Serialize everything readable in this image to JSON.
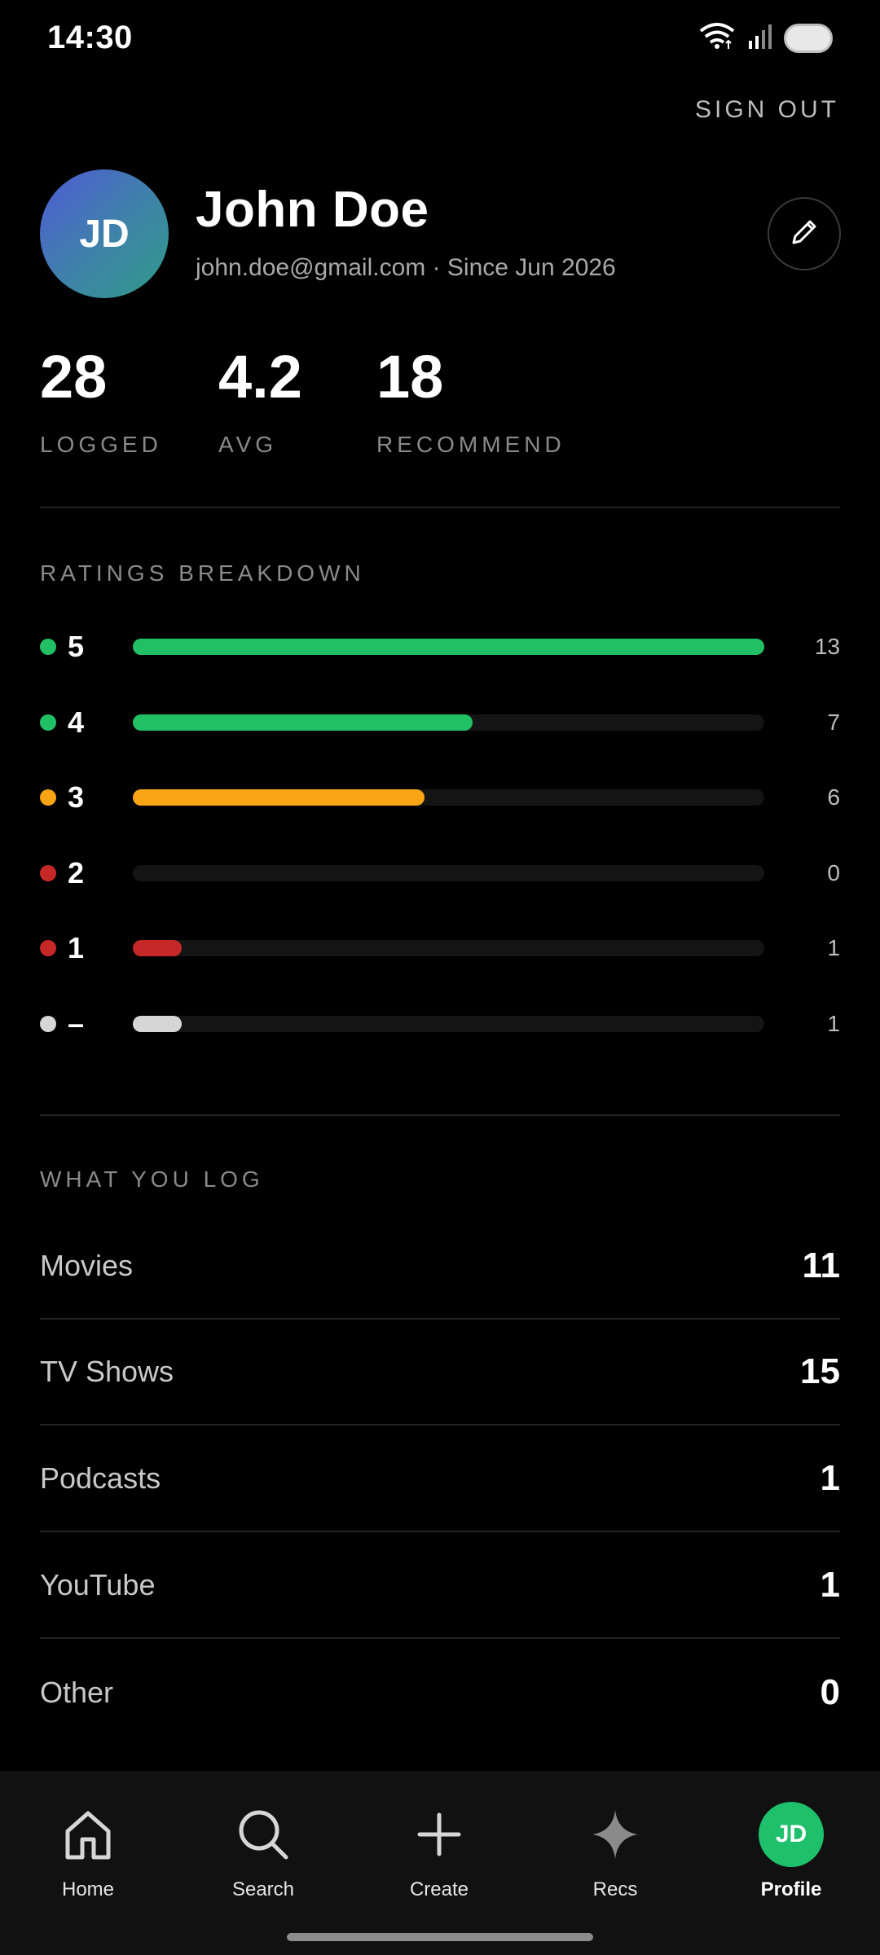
{
  "status": {
    "time": "14:30"
  },
  "header": {
    "sign_out": "SIGN OUT"
  },
  "profile": {
    "initials": "JD",
    "name": "John Doe",
    "subline": "john.doe@gmail.com · Since Jun 2026"
  },
  "stats": [
    {
      "value": "28",
      "label": "LOGGED"
    },
    {
      "value": "4.2",
      "label": "AVG"
    },
    {
      "value": "18",
      "label": "RECOMMEND"
    }
  ],
  "ratings": {
    "title": "RATINGS BREAKDOWN",
    "max": 13,
    "rows": [
      {
        "label": "5",
        "count": "13",
        "value": 13,
        "color": "#22c065"
      },
      {
        "label": "4",
        "count": "7",
        "value": 7,
        "color": "#22c065"
      },
      {
        "label": "3",
        "count": "6",
        "value": 6,
        "color": "#f9a415"
      },
      {
        "label": "2",
        "count": "0",
        "value": 0,
        "color": "#c62828"
      },
      {
        "label": "1",
        "count": "1",
        "value": 1,
        "color": "#c62828"
      },
      {
        "label": "–",
        "count": "1",
        "value": 1,
        "color": "#d6d6d6"
      }
    ]
  },
  "log": {
    "title": "WHAT YOU LOG",
    "rows": [
      {
        "label": "Movies",
        "value": "11"
      },
      {
        "label": "TV Shows",
        "value": "15"
      },
      {
        "label": "Podcasts",
        "value": "1"
      },
      {
        "label": "YouTube",
        "value": "1"
      },
      {
        "label": "Other",
        "value": "0"
      }
    ]
  },
  "nav": {
    "items": [
      {
        "label": "Home",
        "icon": "home-icon"
      },
      {
        "label": "Search",
        "icon": "search-icon"
      },
      {
        "label": "Create",
        "icon": "plus-icon"
      },
      {
        "label": "Recs",
        "icon": "sparkle-icon"
      },
      {
        "label": "Profile",
        "icon": "avatar",
        "initials": "JD",
        "active": true
      }
    ]
  }
}
